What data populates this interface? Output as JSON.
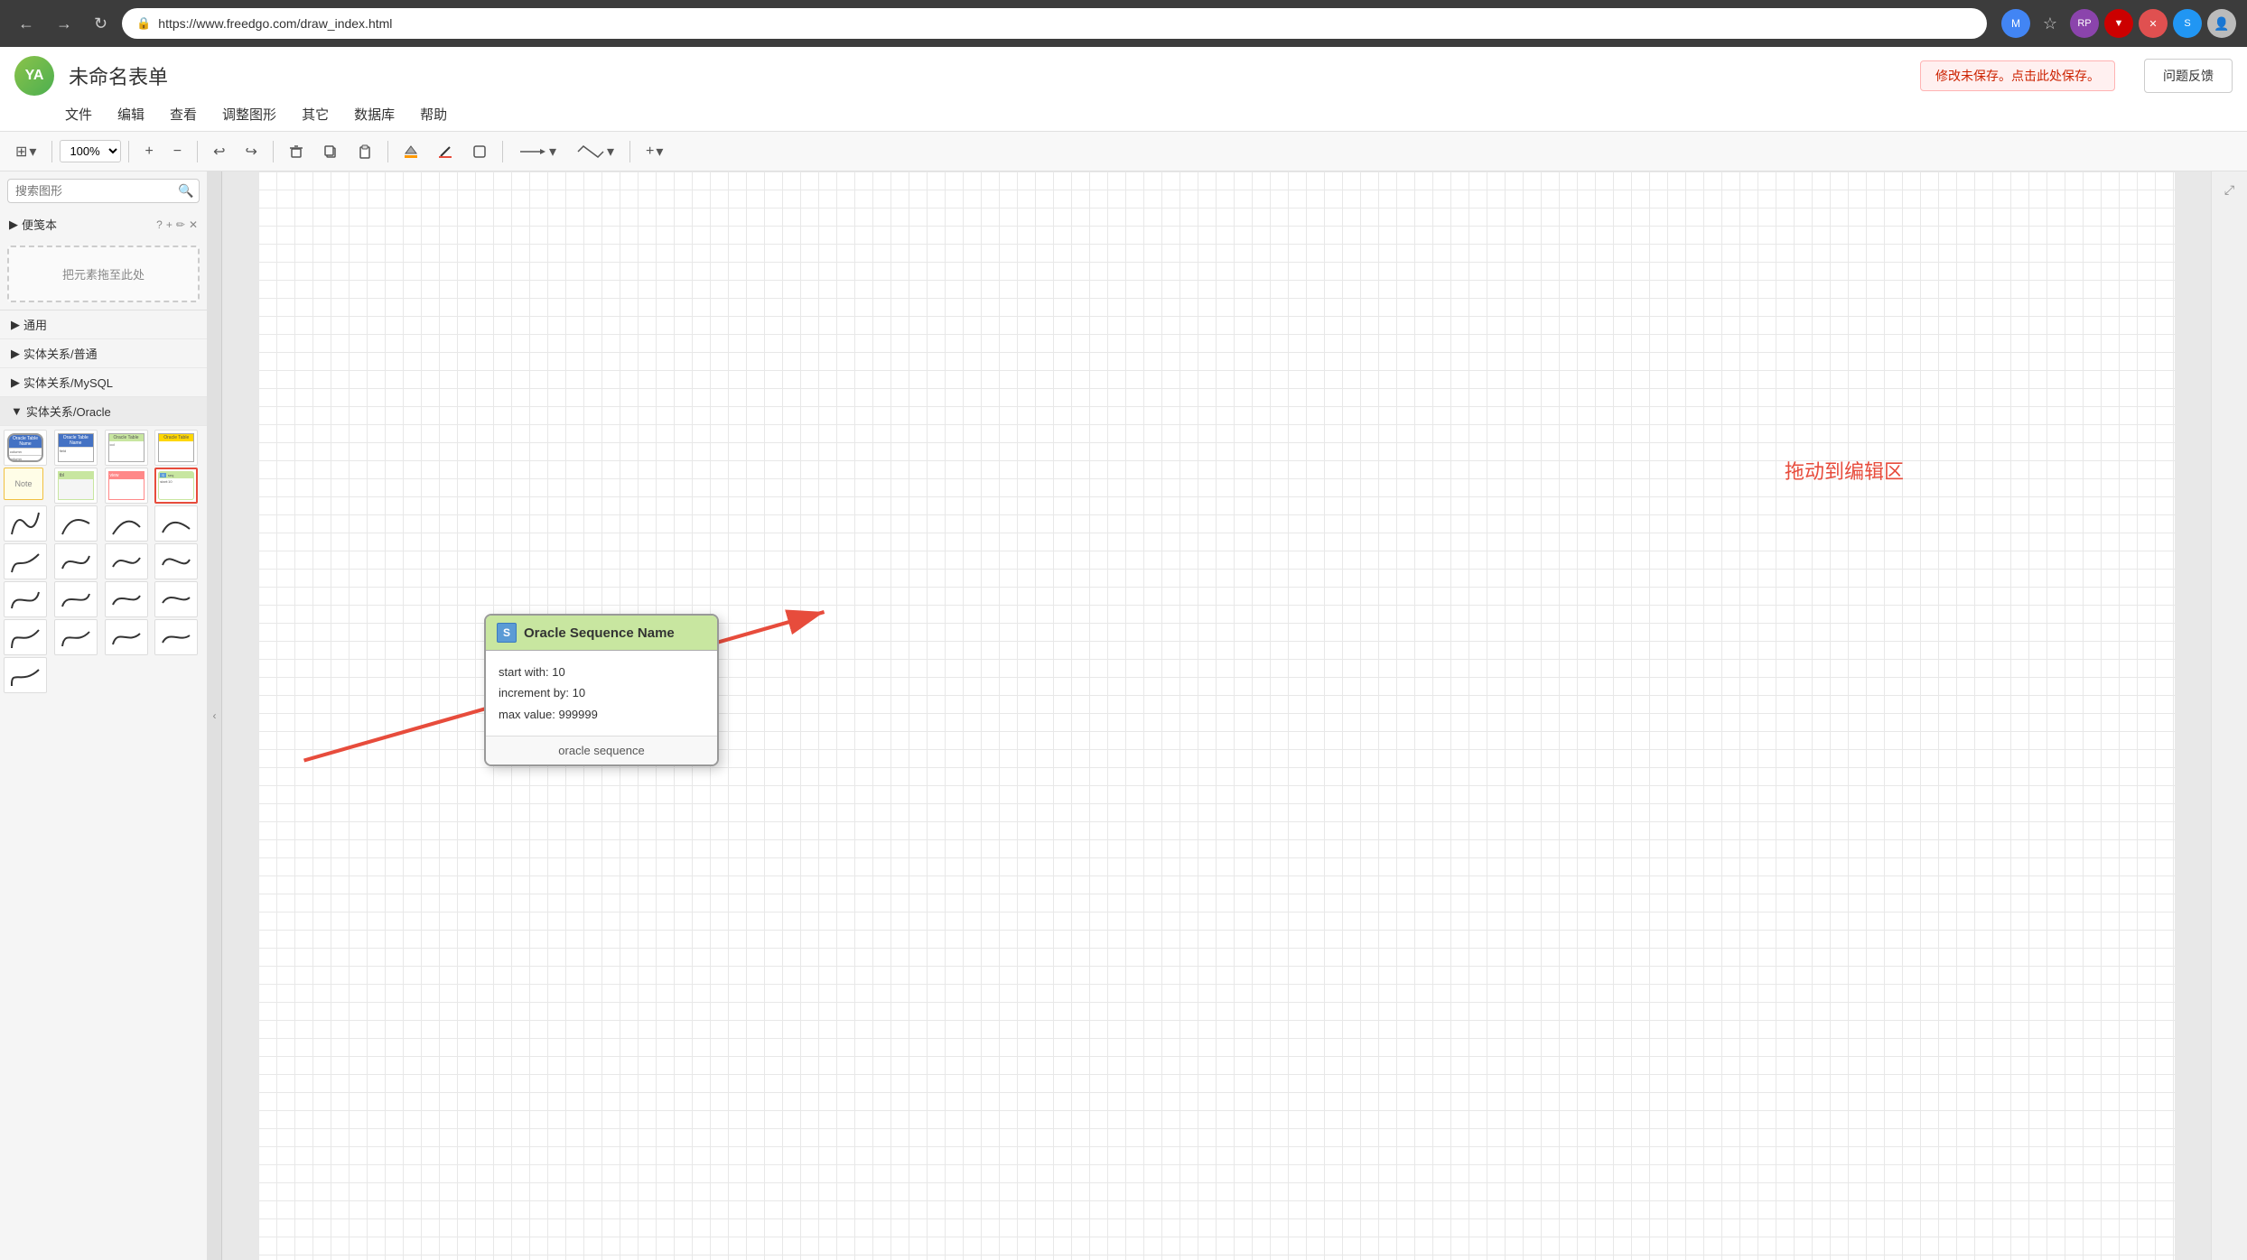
{
  "browser": {
    "back_label": "←",
    "forward_label": "→",
    "refresh_label": "↻",
    "url": "https://www.freedgo.com/draw_index.html",
    "lock_icon": "🔒"
  },
  "app": {
    "logo_text": "YA",
    "title": "未命名表单",
    "unsaved_notice": "修改未保存。点击此处保存。",
    "feedback_btn": "问题反馈"
  },
  "menu": {
    "items": [
      "文件",
      "编辑",
      "查看",
      "调整图形",
      "其它",
      "数据库",
      "帮助"
    ]
  },
  "toolbar": {
    "zoom_level": "100%",
    "zoom_in": "+",
    "zoom_out": "−",
    "undo": "↩",
    "redo": "↪",
    "delete": "🗑",
    "copy": "⎘",
    "paste": "📋",
    "fill": "◆",
    "stroke": "✏",
    "shape": "⬜",
    "connector": "→",
    "waypoint": "⤴",
    "add": "+"
  },
  "sidebar": {
    "search_placeholder": "搜索图形",
    "section_label": "便笺本",
    "drop_zone_label": "把元素拖至此处",
    "categories": [
      {
        "label": "通用",
        "arrow": "▶"
      },
      {
        "label": "实体关系/普通",
        "arrow": "▶"
      },
      {
        "label": "实体关系/MySQL",
        "arrow": "▶"
      },
      {
        "label": "实体关系/Oracle",
        "arrow": "▶"
      }
    ],
    "oracle_selected_index": 3
  },
  "canvas": {
    "drag_label": "拖动到编辑区"
  },
  "tooltip": {
    "header_icon": "S",
    "title": "Oracle Sequence Name",
    "line1": "start with: 10",
    "line2": "increment by: 10",
    "line3": "max value: 999999",
    "footer": "oracle sequence"
  }
}
